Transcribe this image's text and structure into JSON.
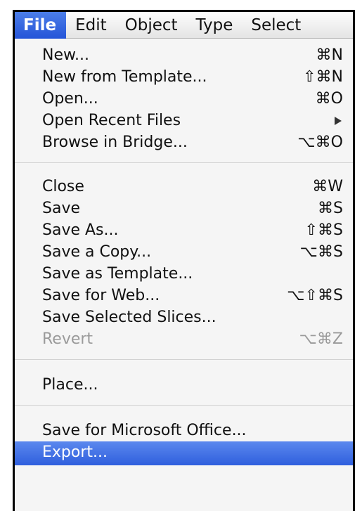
{
  "menubar": {
    "items": [
      "File",
      "Edit",
      "Object",
      "Type",
      "Select"
    ]
  },
  "menu": {
    "items": [
      {
        "label": "New...",
        "shortcut": "⌘N"
      },
      {
        "label": "New from Template...",
        "shortcut": "⇧⌘N"
      },
      {
        "label": "Open...",
        "shortcut": "⌘O"
      },
      {
        "label": "Open Recent Files",
        "shortcut": ""
      },
      {
        "label": "Browse in Bridge...",
        "shortcut": "⌥⌘O"
      },
      {
        "label": "Close",
        "shortcut": "⌘W"
      },
      {
        "label": "Save",
        "shortcut": "⌘S"
      },
      {
        "label": "Save As...",
        "shortcut": "⇧⌘S"
      },
      {
        "label": "Save a Copy...",
        "shortcut": "⌥⌘S"
      },
      {
        "label": "Save as Template...",
        "shortcut": ""
      },
      {
        "label": "Save for Web...",
        "shortcut": "⌥⇧⌘S"
      },
      {
        "label": "Save Selected Slices...",
        "shortcut": ""
      },
      {
        "label": "Revert",
        "shortcut": "⌥⌘Z"
      },
      {
        "label": "Place...",
        "shortcut": ""
      },
      {
        "label": "Save for Microsoft Office...",
        "shortcut": ""
      },
      {
        "label": "Export...",
        "shortcut": ""
      }
    ]
  }
}
